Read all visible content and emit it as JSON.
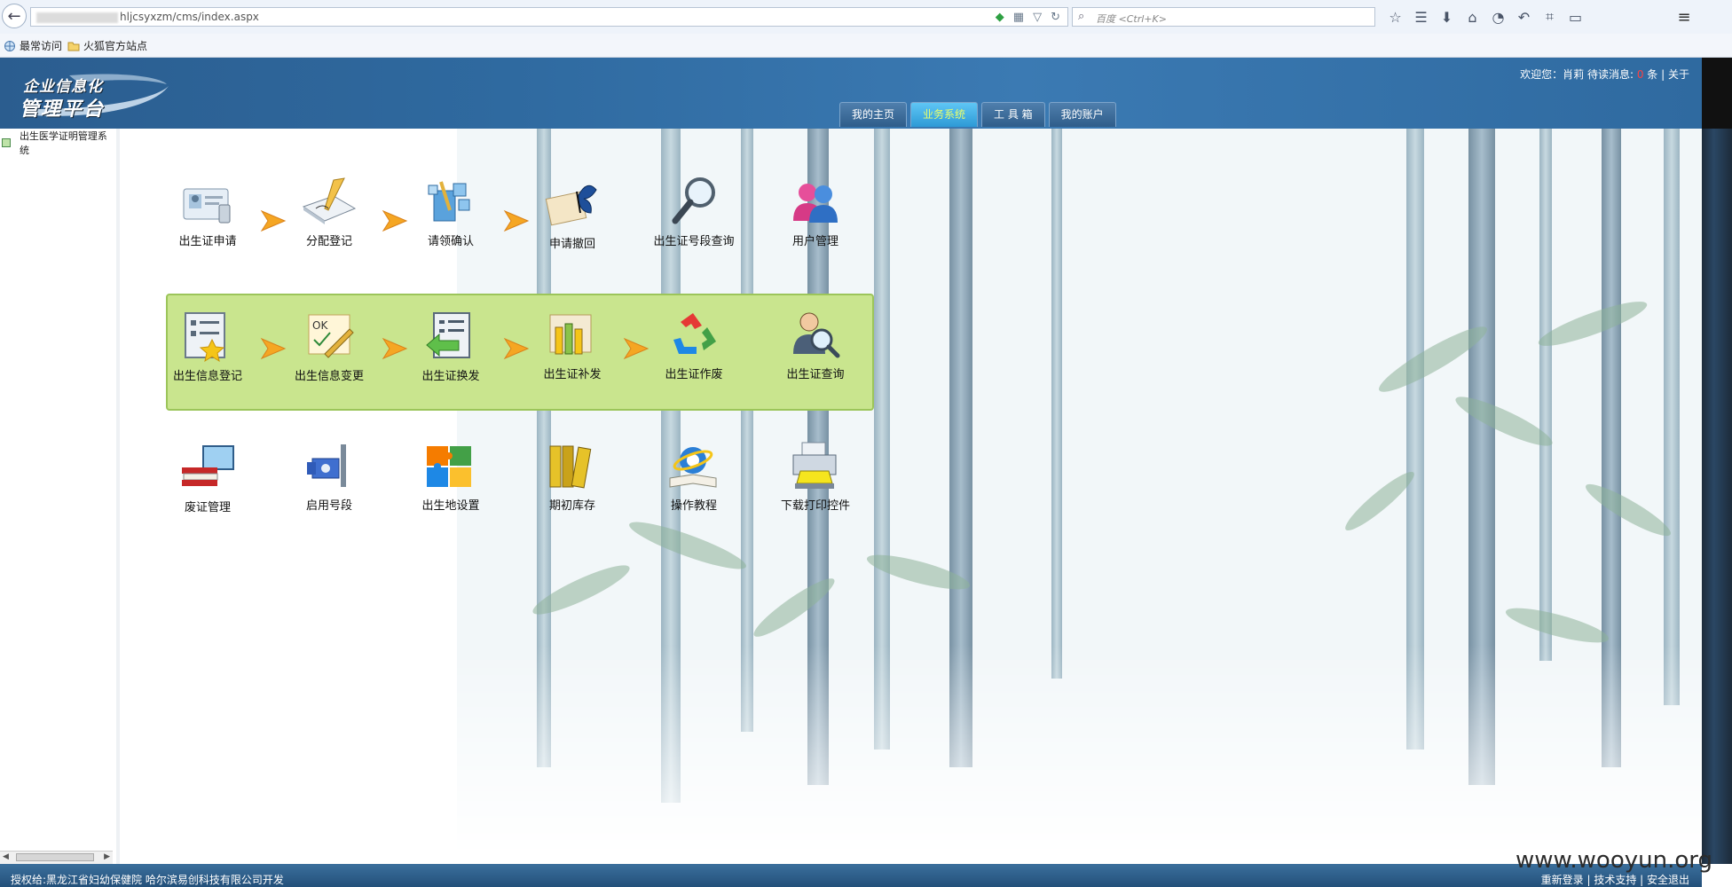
{
  "browser": {
    "url": "hljcsyxzm/cms/index.aspx",
    "search_placeholder": "百度 <Ctrl+K>",
    "bookmarks": [
      "最常访问",
      "火狐官方站点"
    ]
  },
  "header": {
    "logo_line1": "企业信息化",
    "logo_line2": "管理平台",
    "welcome_prefix": "欢迎您：肖莉 待读消息:",
    "message_count": "0",
    "welcome_suffix": "条",
    "about": "关于",
    "tabs": [
      "我的主页",
      "业务系统",
      "工 具 箱",
      "我的账户"
    ],
    "active_tab": "业务系统"
  },
  "sidebar": {
    "items": [
      "出生医学证明管理系统"
    ]
  },
  "apps": {
    "row1": [
      "出生证申请",
      "分配登记",
      "请领确认",
      "申请撤回",
      "出生证号段查询",
      "用户管理"
    ],
    "row2": [
      "出生信息登记",
      "出生信息变更",
      "出生证换发",
      "出生证补发",
      "出生证作废",
      "出生证查询"
    ],
    "row3": [
      "废证管理",
      "启用号段",
      "出生地设置",
      "期初库存",
      "操作教程",
      "下载打印控件"
    ]
  },
  "footer": {
    "left": "授权给:黑龙江省妇幼保健院  哈尔滨易创科技有限公司开发",
    "right": "重新登录 | 技术支持 | 安全退出"
  },
  "watermark": "www.wooyun.org",
  "colors": {
    "header_blue": "#2f6aa0",
    "active_tab": "#2d9ad6",
    "panel_green": "#c9e58e"
  }
}
